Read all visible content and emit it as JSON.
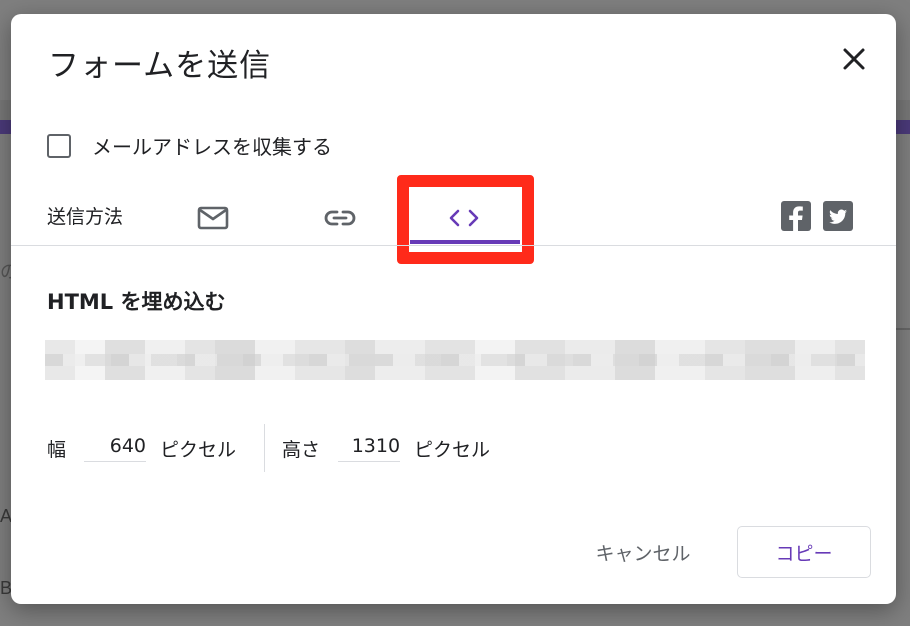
{
  "dialog": {
    "title": "フォームを送信",
    "collect_email_label": "メールアドレスを収集する",
    "send_via_label": "送信方法",
    "tabs": [
      {
        "name": "email",
        "icon": "mail-icon"
      },
      {
        "name": "link",
        "icon": "link-icon"
      },
      {
        "name": "embed",
        "icon": "code-icon",
        "active": true
      }
    ],
    "social": [
      {
        "name": "facebook",
        "icon": "facebook-icon"
      },
      {
        "name": "twitter",
        "icon": "twitter-icon"
      }
    ],
    "embed_section_title": "HTML を埋め込む",
    "width_label": "幅",
    "width_value": "640",
    "height_label": "高さ",
    "height_value": "1310",
    "unit_label": "ピクセル",
    "cancel_label": "キャンセル",
    "copy_label": "コピー"
  },
  "background_letters": [
    "の",
    "A",
    "B"
  ],
  "colors": {
    "accent": "#673ab7",
    "highlight": "#ff2a1a",
    "text": "#202124",
    "icon": "#5f6368"
  }
}
